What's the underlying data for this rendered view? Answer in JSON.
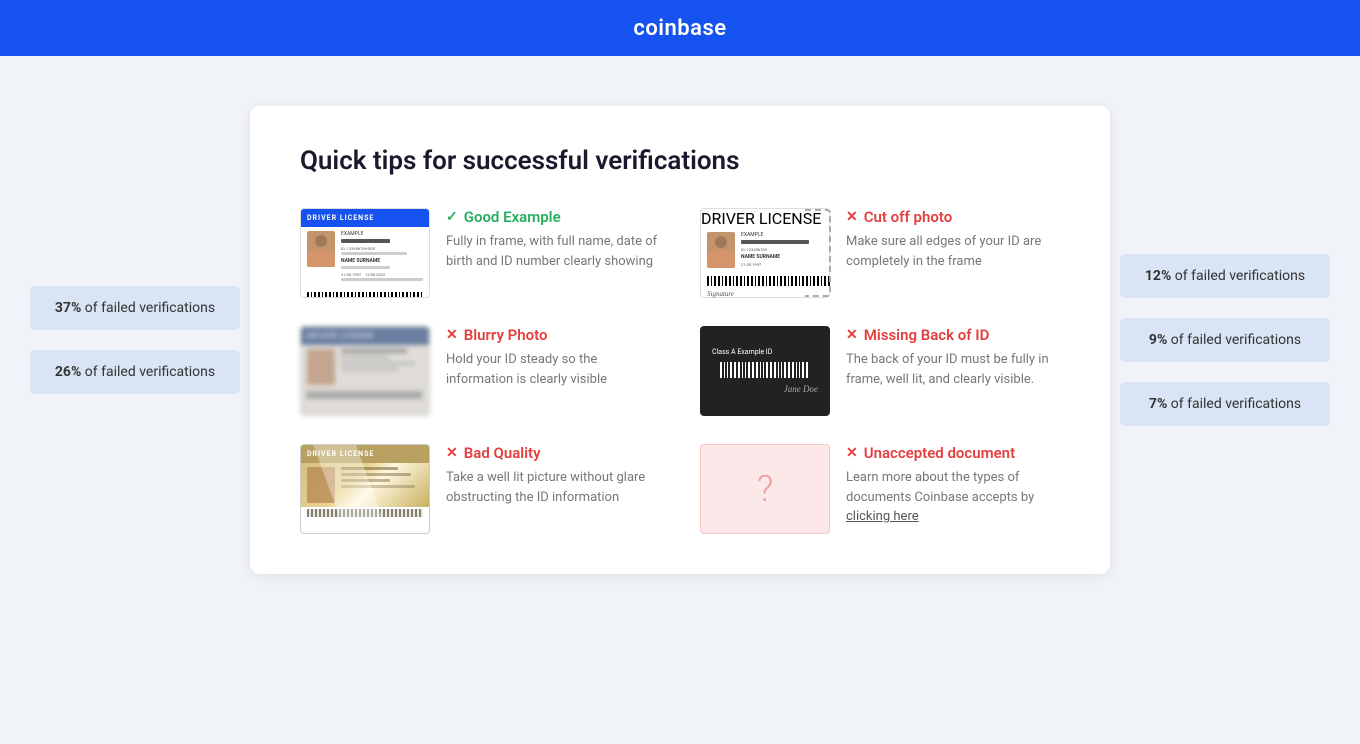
{
  "header": {
    "logo": "coinbase"
  },
  "main": {
    "card_title": "Quick tips for successful verifications",
    "tips": [
      {
        "id": "good-example",
        "type": "good",
        "title": "Good Example",
        "description": "Fully in frame, with full name, date of birth and ID number clearly showing",
        "thumb_type": "good"
      },
      {
        "id": "cut-off-photo",
        "type": "bad",
        "title": "Cut off photo",
        "description": "Make sure all edges of your ID are completely in the frame",
        "thumb_type": "cutoff"
      },
      {
        "id": "blurry-photo",
        "type": "bad",
        "title": "Blurry Photo",
        "description": "Hold your ID steady so the information is clearly visible",
        "thumb_type": "blurry"
      },
      {
        "id": "missing-back",
        "type": "bad",
        "title": "Missing Back of ID",
        "description": "The back of your ID must be fully in frame, well lit, and clearly visible.",
        "thumb_type": "back"
      },
      {
        "id": "bad-quality",
        "type": "bad",
        "title": "Bad Quality",
        "description": "Take a well lit picture without glare obstructing the ID information",
        "thumb_type": "badquality"
      },
      {
        "id": "unaccepted-document",
        "type": "bad",
        "title": "Unaccepted document",
        "description": "Learn more about the types of documents Coinbase accepts by",
        "link_text": "clicking here",
        "thumb_type": "unaccepted"
      }
    ],
    "side_stats_left": [
      {
        "percent": "37%",
        "label": "of failed verifications"
      },
      {
        "percent": "26%",
        "label": "of failed verifications"
      }
    ],
    "side_stats_right": [
      {
        "percent": "12%",
        "label": "of failed verifications"
      },
      {
        "percent": "9%",
        "label": "of failed verifications"
      },
      {
        "percent": "7%",
        "label": "of failed verifications"
      }
    ]
  }
}
